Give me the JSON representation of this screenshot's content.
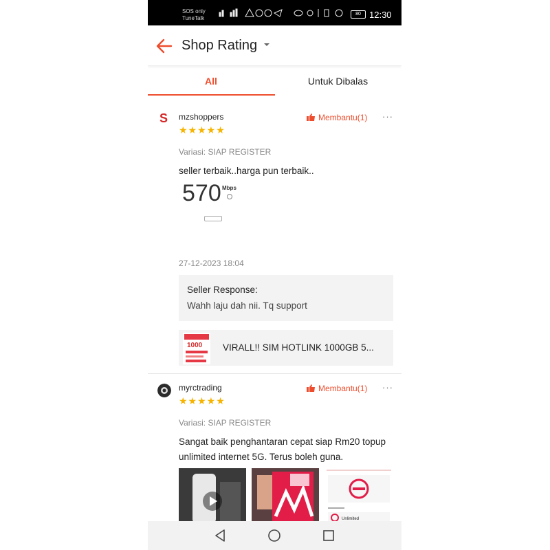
{
  "status_bar": {
    "carrier_line1": "SOS only",
    "carrier_line2": "TuneTalk",
    "battery": "80",
    "time": "12:30"
  },
  "header": {
    "title": "Shop Rating"
  },
  "tabs": [
    {
      "label": "All",
      "active": true
    },
    {
      "label": "Untuk Dibalas",
      "active": false
    }
  ],
  "reviews": [
    {
      "username": "mzshoppers",
      "stars": "★★★★★",
      "rating": 5,
      "helpful_label": "Membantu(1)",
      "more": "···",
      "variation": "Variasi: SIAP REGISTER",
      "comment": "seller terbaik..harga pun terbaik..",
      "speed_value": "570",
      "speed_unit": "Mbps",
      "date": "27-12-2023 18:04",
      "seller_response_title": "Seller Response:",
      "seller_response_text": "Wahh laju dah nii. Tq support",
      "product_name": "VIRALL!! SIM HOTLINK 1000GB 5...",
      "product_thumb_text": "1000"
    },
    {
      "username": "myrctrading",
      "stars": "★★★★★",
      "rating": 5,
      "helpful_label": "Membantu(1)",
      "more": "···",
      "variation": "Variasi: SIAP REGISTER",
      "comment": "Sangat baik penghantaran cepat siap Rm20 topup unlimited internet 5G. Terus boleh guna.",
      "photo3_label": "Unlimited"
    }
  ],
  "colors": {
    "accent": "#ee4d2d",
    "star": "#f6b400"
  }
}
